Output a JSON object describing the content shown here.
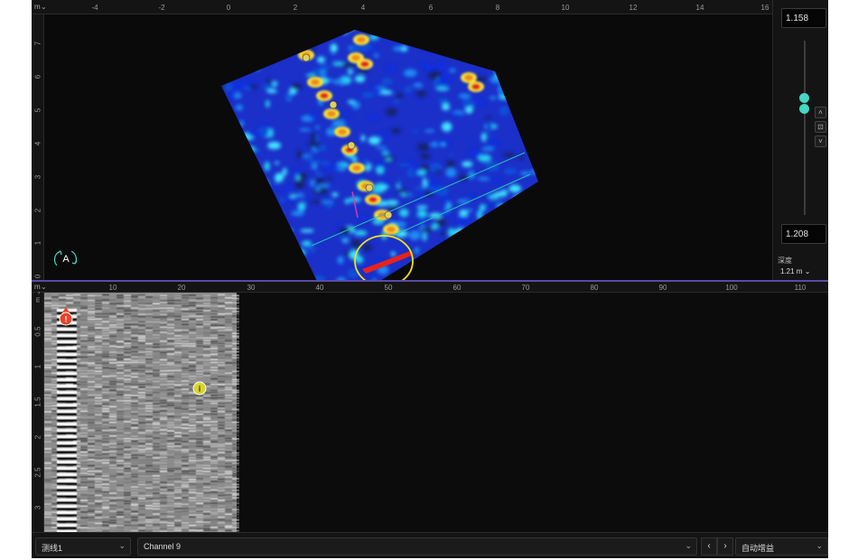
{
  "plan_view": {
    "axis_unit": "m",
    "x_ticks": [
      "-4",
      "-2",
      "0",
      "2",
      "4",
      "6",
      "8",
      "10",
      "12",
      "14",
      "16"
    ],
    "y_ticks": [
      "0",
      "1",
      "2",
      "3",
      "4",
      "5",
      "6",
      "7"
    ],
    "north_arrow_label": "A"
  },
  "depth_panel": {
    "top_value": "1.158",
    "bottom_value": "1.208",
    "label": "深度",
    "value": "1.21 m"
  },
  "section_view": {
    "axis_unit": "m",
    "x_ticks": [
      "10",
      "20",
      "30",
      "40",
      "50",
      "60",
      "70",
      "80",
      "90",
      "100",
      "110"
    ],
    "y_ticks": [
      "0.5",
      "1",
      "1.5",
      "2",
      "2.5",
      "3"
    ]
  },
  "toolbar": {
    "line_select": "测线1",
    "channel_select": "Channel 9",
    "prev": "‹",
    "next": "›",
    "gain_select": "自动增益"
  },
  "colors": {
    "accent": "#45d6c4",
    "divider": "#5b4aa8",
    "highlight_circle": "#f2e01a",
    "marker_red": "#e8432a",
    "marker_yellow": "#d8d42a"
  }
}
